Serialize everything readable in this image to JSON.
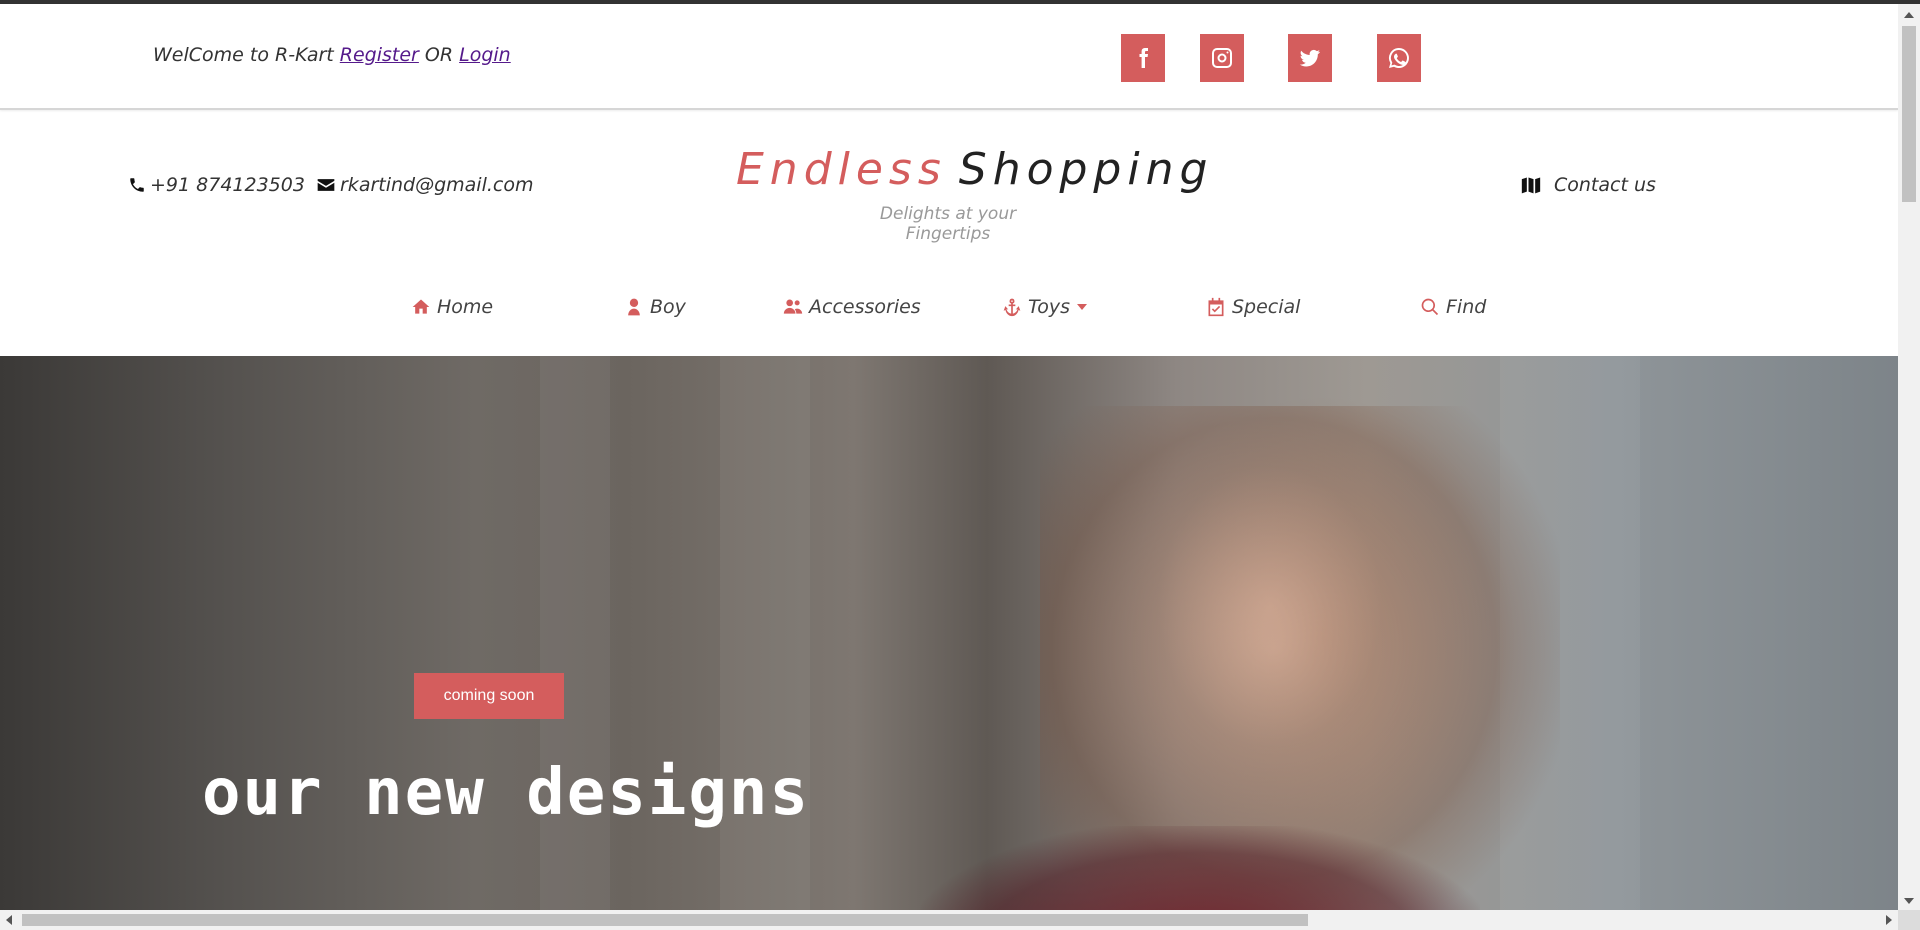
{
  "topbar": {
    "welcome_prefix": "WelCome to R-Kart ",
    "register_link": "Register",
    "or_text": " OR ",
    "login_link": "Login",
    "social_icons": [
      "facebook-icon",
      "instagram-icon",
      "twitter-icon",
      "whatsapp-icon"
    ]
  },
  "header": {
    "phone": "+91 874123503",
    "email": "rkartind@gmail.com",
    "brand_first": "Endless",
    "brand_second": "Shopping",
    "tagline": "Delights at your Fingertips",
    "contact_label": "Contact us"
  },
  "nav": {
    "items": [
      {
        "label": "Home",
        "icon": "home-icon"
      },
      {
        "label": "Boy",
        "icon": "user-icon"
      },
      {
        "label": "Accessories",
        "icon": "users-icon"
      },
      {
        "label": "Toys",
        "icon": "anchor-icon"
      },
      {
        "label": "Special",
        "icon": "calendar-check-icon"
      },
      {
        "label": "Find",
        "icon": "search-icon"
      }
    ]
  },
  "hero": {
    "badge": "coming soon",
    "title": "our new designs"
  },
  "colors": {
    "accent": "#d45d5d",
    "text": "#333333",
    "muted": "#999999"
  }
}
